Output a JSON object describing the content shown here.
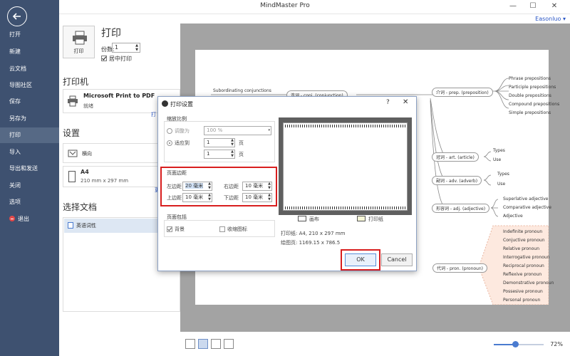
{
  "app": {
    "title": "MindMaster Pro",
    "user": "Easonluo"
  },
  "window": {
    "min": "—",
    "max": "☐",
    "close": "✕"
  },
  "sidebar": {
    "items": [
      {
        "label": "打开"
      },
      {
        "label": "新建"
      },
      {
        "label": "云文档"
      },
      {
        "label": "导图社区"
      },
      {
        "label": "保存"
      },
      {
        "label": "另存为"
      },
      {
        "label": "打印"
      },
      {
        "label": "导入"
      },
      {
        "label": "导出和发送"
      },
      {
        "label": "关闭"
      },
      {
        "label": "选项"
      },
      {
        "label": "退出"
      }
    ],
    "active_index": 6
  },
  "panel": {
    "print_button": "打印",
    "heading": "打印",
    "copies_label": "份数:",
    "copies_value": "1",
    "center_label": "居中打印",
    "printer_heading": "打印机",
    "printer_name": "Microsoft Print to PDF",
    "printer_status": "就绪",
    "printer_props": "打",
    "settings_heading": "设置",
    "orientation": "横向",
    "size_name": "A4",
    "size_dims": "210 mm x 297 mm",
    "size_more": "更",
    "select_doc_heading": "选择文档",
    "doc_name": "英语词性"
  },
  "mindmap": {
    "left_top": "Subordinating conjunctions",
    "nodes": [
      {
        "label": "连词 - conj. (conjunction)"
      },
      {
        "label": "介词 - prep. (preposition)"
      },
      {
        "label": "冠词 - art. (article)"
      },
      {
        "label": "副词 - adv. (adverb)"
      },
      {
        "label": "形容词 - adj. (adjective)"
      },
      {
        "label": "代词 - pron. (pronoun)"
      }
    ],
    "prep_children": [
      "Phrase prepositions",
      "Participle prepositions",
      "Double prepositions",
      "Compound prepositions",
      "Simple prepositions"
    ],
    "art_children": [
      "Types",
      "Use"
    ],
    "adv_children": [
      "Types",
      "Use"
    ],
    "adj_children": [
      "Superlative adjective",
      "Comparative adjective",
      "Adjective"
    ],
    "pron_children": [
      "Indefinite pronoun",
      "Conjuctive pronoun",
      "Relative pronoun",
      "Interrogative pronoun",
      "Reciprocal pronoun",
      "Reflexive pronoun",
      "Demonstrative pronoun",
      "Possesive pronoun",
      "Personal pronoun"
    ]
  },
  "bottombar": {
    "zoom": "72%",
    "zoom_fraction": 0.43
  },
  "dialog": {
    "title": "打印设置",
    "help": "?",
    "close": "✕",
    "scale_group": "缩放比例",
    "adjust_label": "调整为",
    "adjust_value": "100 %",
    "fit_label": "适应到",
    "fit_value1": "1",
    "fit_value2": "1",
    "page_unit": "页",
    "margins_group": "页面边距",
    "left_label": "左边距",
    "left_value": "20 毫米",
    "right_label": "右边距",
    "right_value": "10 毫米",
    "top_label": "上边距",
    "top_value": "10 毫米",
    "bottom_label": "下边距",
    "bottom_value": "10 毫米",
    "include_group": "页面包括",
    "background_label": "背景",
    "collapse_label": "收缩图标",
    "legend_canvas": "画布",
    "legend_printable": "打印纸",
    "paper_info": "打印纸:   A4, 210 x 297 mm",
    "draw_info": "绘图页:   1169.15 x 786.5",
    "ok": "OK",
    "cancel": "Cancel"
  },
  "colors": {
    "sidebar_bg": "#3e5170",
    "accent_red": "#d81e1e",
    "link_blue": "#2b57c6"
  }
}
